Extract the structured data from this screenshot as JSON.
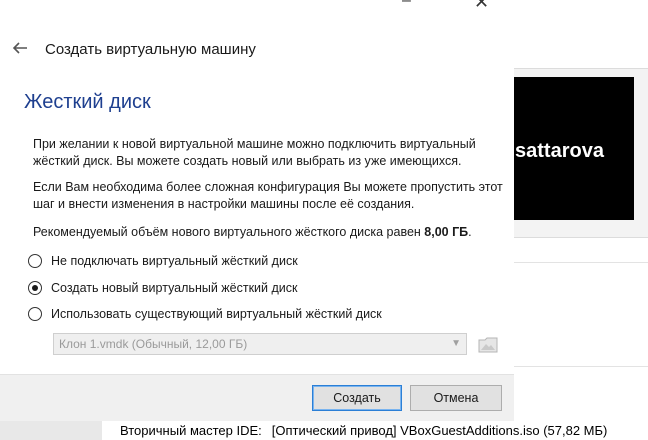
{
  "window": {
    "minimize_glyph": "–",
    "close_glyph": "✕"
  },
  "dialog": {
    "title": "Создать виртуальную машину",
    "back_icon": "back-arrow-icon",
    "section_title": "Жесткий диск",
    "paragraph1": "При желании к новой виртуальной машине можно подключить виртуальный жёсткий диск. Вы можете создать новый или выбрать из уже имеющихся.",
    "paragraph2": "Если Вам необходима более сложная конфигурация Вы можете пропустить этот шаг и внести изменения в настройки машины после её создания.",
    "recommend_prefix": "Рекомендуемый объём нового виртуального жёсткого диска равен ",
    "recommend_size": "8,00 ГБ",
    "recommend_suffix": ".",
    "options": [
      {
        "label": "Не подключать виртуальный жёсткий диск",
        "checked": false
      },
      {
        "label": "Создать новый виртуальный жёсткий диск",
        "checked": true
      },
      {
        "label": "Использовать существующий виртуальный жёсткий диск",
        "checked": false
      }
    ],
    "existing_disk": {
      "selected": "Клон 1.vmdk (Обычный, 12,00 ГБ)",
      "enabled": false
    },
    "buttons": {
      "create": "Создать",
      "cancel": "Отмена"
    }
  },
  "background": {
    "preview_text": "sattarova",
    "ide_label": "Вторичный мастер IDE:",
    "ide_value": "[Оптический привод] VBoxGuestAdditions.iso (57,82 МБ)"
  },
  "colors": {
    "section_title": "#1e3f8f",
    "default_button_border": "#2b7fd6"
  }
}
